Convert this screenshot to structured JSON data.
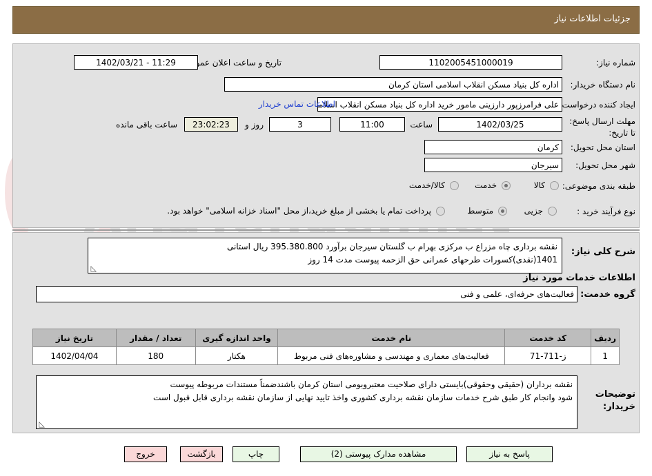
{
  "header": {
    "title": "جزئیات اطلاعات نیاز",
    "bar_color": "#8b6d45"
  },
  "watermark": {
    "text": "AriaTender.net"
  },
  "form": {
    "need_number_label": "شماره نیاز:",
    "need_number_value": "1102005451000019",
    "announce_label": "تاریخ و ساعت اعلان عمومی:",
    "announce_value": "11:29 - 1402/03/21",
    "buyer_org_label": "نام دستگاه خریدار:",
    "buyer_org_value": "اداره کل بنیاد مسکن انقلاب اسلامی استان کرمان",
    "requester_label": "ایجاد کننده درخواست:",
    "requester_value": "علی فرامرزپور دارزینی مامور خرید اداره کل بنیاد مسکن انقلاب اسلامی استان ک",
    "contact_link": "اطلاعات تماس خریدار",
    "deadline_label": "مهلت ارسال پاسخ: تا تاریخ:",
    "deadline_date": "1402/03/25",
    "deadline_hour_label": "ساعت",
    "deadline_hour": "11:00",
    "days_remaining": "3",
    "days_label": "روز و",
    "timer_value": "23:02:23",
    "timer_suffix": "ساعت باقی مانده",
    "province_label": "استان محل تحویل:",
    "province_value": "کرمان",
    "city_label": "شهر محل تحویل:",
    "city_value": "سیرجان",
    "category_label": "طبقه بندی موضوعی:",
    "category_options": [
      "کالا",
      "خدمت",
      "کالا/خدمت"
    ],
    "category_selected": "خدمت",
    "process_label": "نوع فرآیند خرید :",
    "process_options": [
      "جزیی",
      "متوسط"
    ],
    "process_selected": "متوسط",
    "treasury_note": "پرداخت تمام یا بخشی از مبلغ خرید،از محل \"اسناد خزانه اسلامی\" خواهد بود."
  },
  "summary": {
    "label": "شرح کلی نیاز:",
    "line1": "نقشه برداری چاه مزراع ب مرکزی بهرام ب گلستان سیرجان  برآورد 395.380.800 ریال استانی",
    "line2": "1401(نقدی)کسورات طرحهای  عمرانی حق الزحمه پیوست مدت 14 روز"
  },
  "services_section": {
    "heading": "اطلاعات خدمات مورد نیاز",
    "group_label": "گروه خدمت:",
    "group_value": "فعالیت‌های حرفه‌ای، علمی و فنی"
  },
  "table": {
    "columns": [
      "ردیف",
      "کد خدمت",
      "نام خدمت",
      "واحد اندازه گیری",
      "تعداد / مقدار",
      "تاریخ نیاز"
    ],
    "rows": [
      {
        "row": "1",
        "code": "ز-711-71",
        "name": "فعالیت‌های معماری و مهندسی و مشاوره‌های فنی مربوط",
        "unit": "هکتار",
        "qty": "180",
        "date": "1402/04/04"
      }
    ]
  },
  "buyer_notes": {
    "label_line1": "توضیحات",
    "label_line2": "خریدار:",
    "line1": "نقشه برداران (حقیقی وحقوقی)بایستی دارای صلاحیت معتبروبومی استان کرمان باشندضمناً مستندات مربوطه پیوست",
    "line2": "شود وانجام کار طبق شرح خدمات سازمان نقشه برداری کشوری واخذ تایید نهایی از سازمان نقشه برداری قابل قبول است"
  },
  "buttons": [
    {
      "id": "respond",
      "label": "پاسخ به نیاز",
      "style": "green"
    },
    {
      "id": "view-docs",
      "label": "مشاهده مدارک پیوستی (2)",
      "style": "green"
    },
    {
      "id": "print",
      "label": "چاپ",
      "style": "green"
    },
    {
      "id": "back",
      "label": "بازگشت",
      "style": "red"
    },
    {
      "id": "exit",
      "label": "خروج",
      "style": "red"
    }
  ]
}
